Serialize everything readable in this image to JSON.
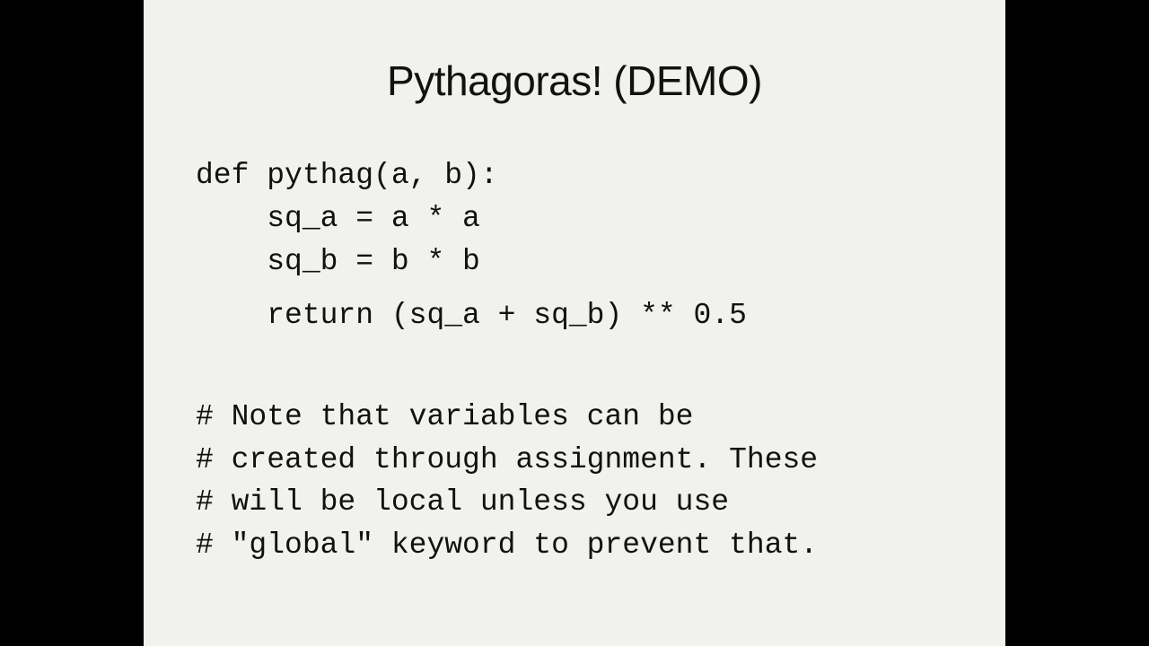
{
  "slide": {
    "title": "Pythagoras! (DEMO)",
    "code": [
      "def pythag(a, b):",
      "    sq_a = a * a",
      "    sq_b = b * b",
      "    return (sq_a + sq_b) ** 0.5"
    ],
    "comments": [
      "# Note that variables can be",
      "# created through assignment. These",
      "# will be local unless you use",
      "# \"global\" keyword to prevent that."
    ]
  },
  "colors": {
    "letterbox": "#000000",
    "slide_background": "#f1f1ed",
    "text": "#111111"
  }
}
